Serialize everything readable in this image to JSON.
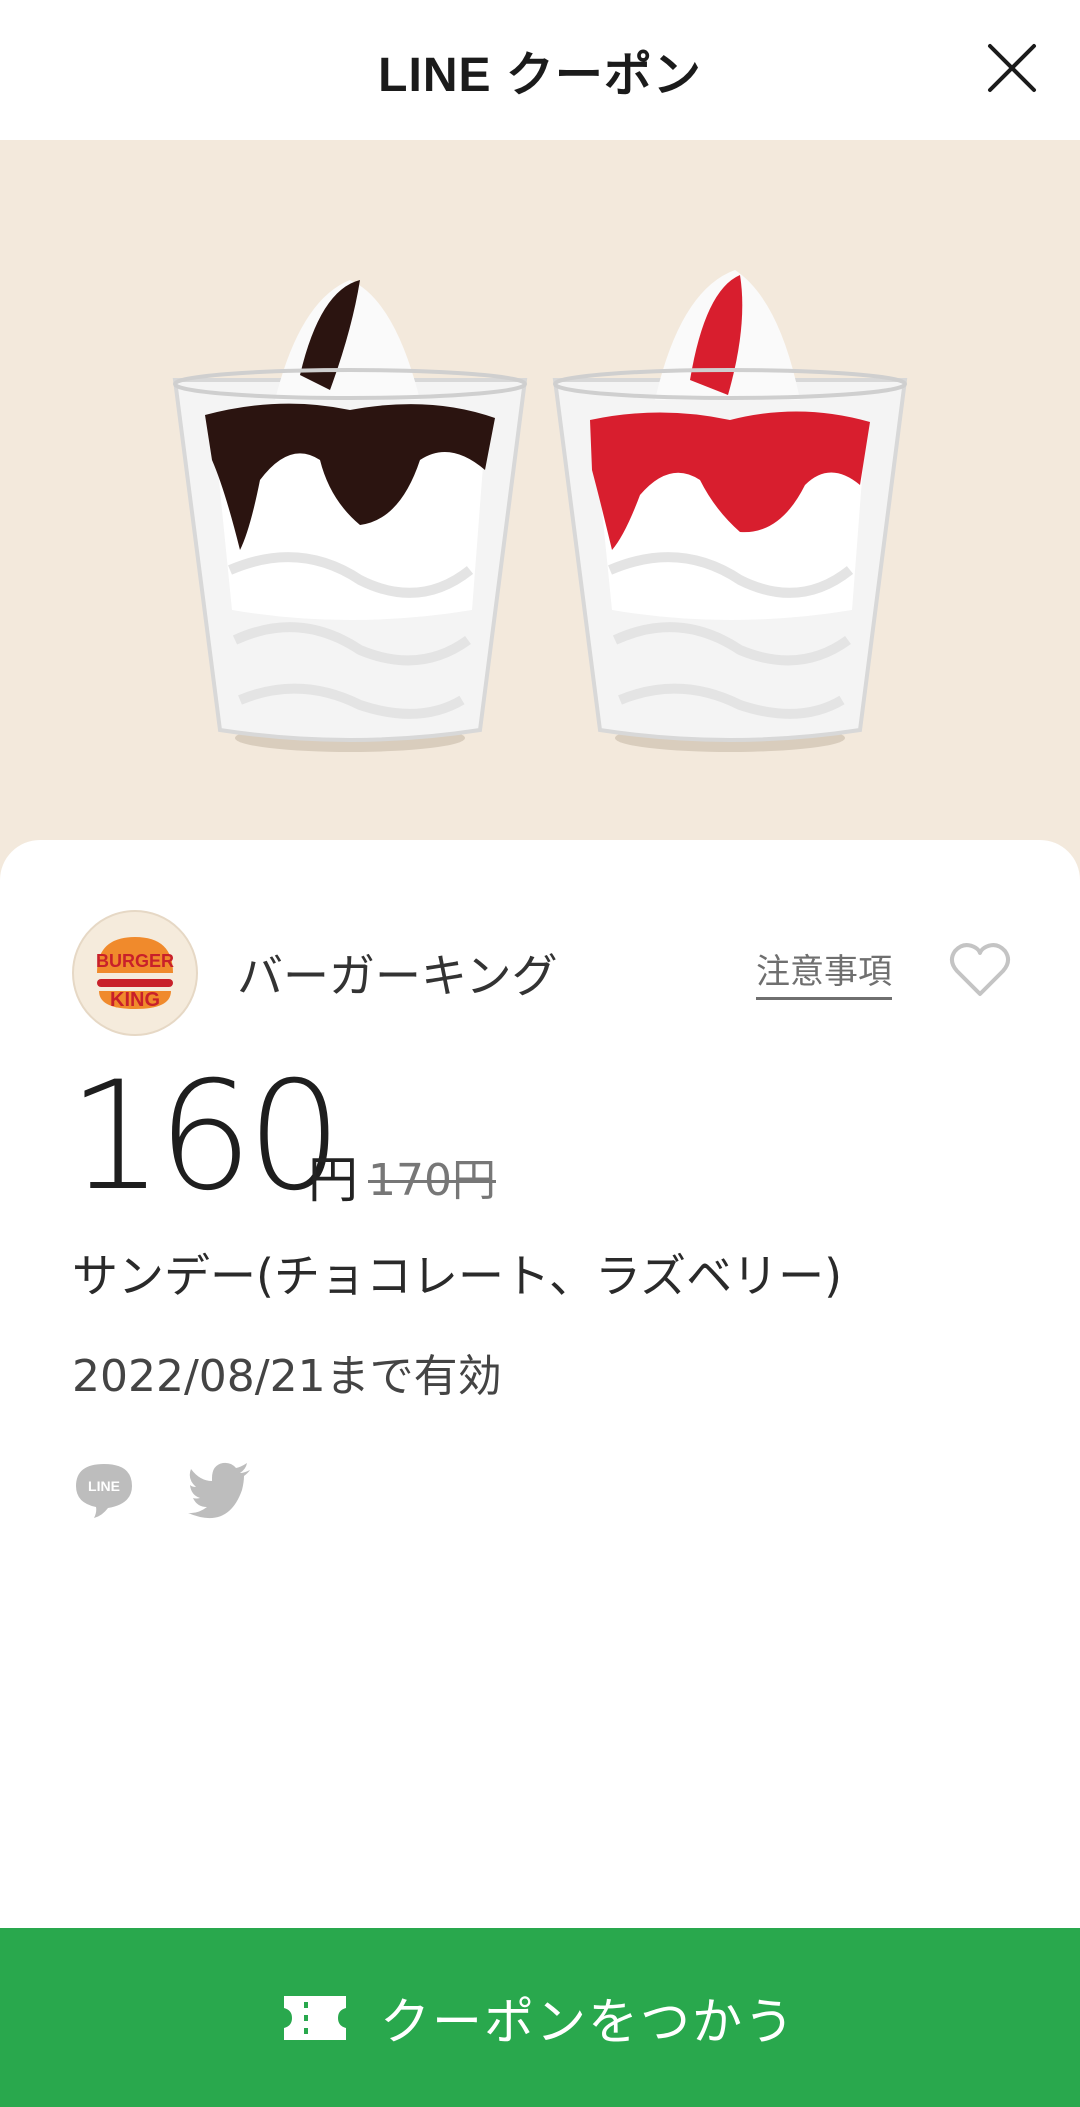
{
  "header": {
    "title": "LINE クーポン"
  },
  "brand": {
    "name": "バーガーキング",
    "logo_text_top": "BURGER",
    "logo_text_bottom": "KING",
    "notes_label": "注意事項"
  },
  "price": {
    "current": "160",
    "unit": "円",
    "original": "170円"
  },
  "product": {
    "name": "サンデー(チョコレート、ラズベリー)"
  },
  "validity": {
    "text": "2022/08/21まで有効"
  },
  "share": {
    "line_label": "LINE"
  },
  "action": {
    "use_label": "クーポンをつかう"
  },
  "colors": {
    "accent": "#29a84d",
    "hero_bg": "#f3e9dc",
    "chocolate": "#2b1410",
    "raspberry": "#d81e2e"
  },
  "icons": [
    "close-icon",
    "heart-icon",
    "line-icon",
    "twitter-icon",
    "ticket-icon"
  ]
}
